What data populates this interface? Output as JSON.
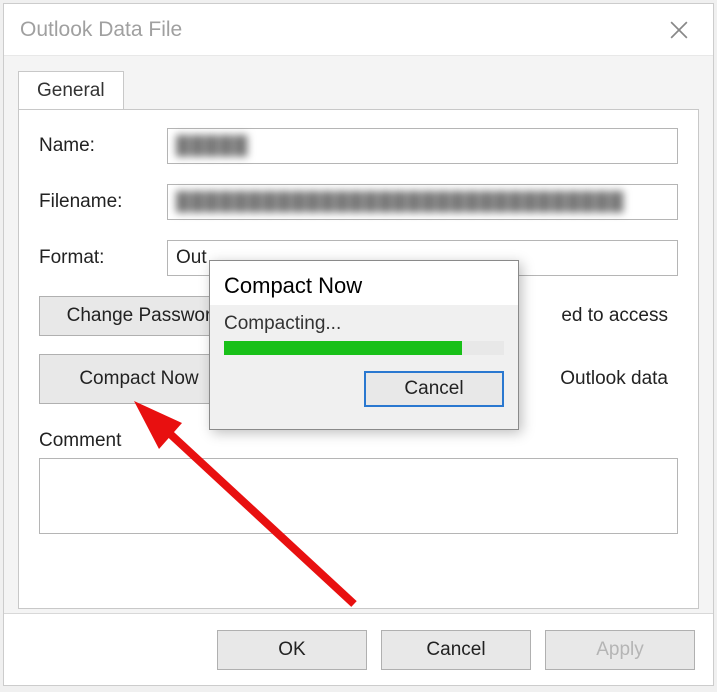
{
  "window": {
    "title": "Outlook Data File"
  },
  "tabs": {
    "general": "General"
  },
  "form": {
    "name_label": "Name:",
    "name_value": "█████",
    "filename_label": "Filename:",
    "filename_value": "███████████████████████████████",
    "format_label": "Format:",
    "format_value": "Out"
  },
  "buttons": {
    "change_password_label": "Change Passwor",
    "change_password_desc": "ed to access",
    "compact_now_label": "Compact Now",
    "compact_now_desc": "Outlook data"
  },
  "comment": {
    "label": "Comment",
    "value": ""
  },
  "footer": {
    "ok": "OK",
    "cancel": "Cancel",
    "apply": "Apply"
  },
  "modal": {
    "title": "Compact Now",
    "status": "Compacting...",
    "progress_percent": 85,
    "cancel": "Cancel"
  }
}
